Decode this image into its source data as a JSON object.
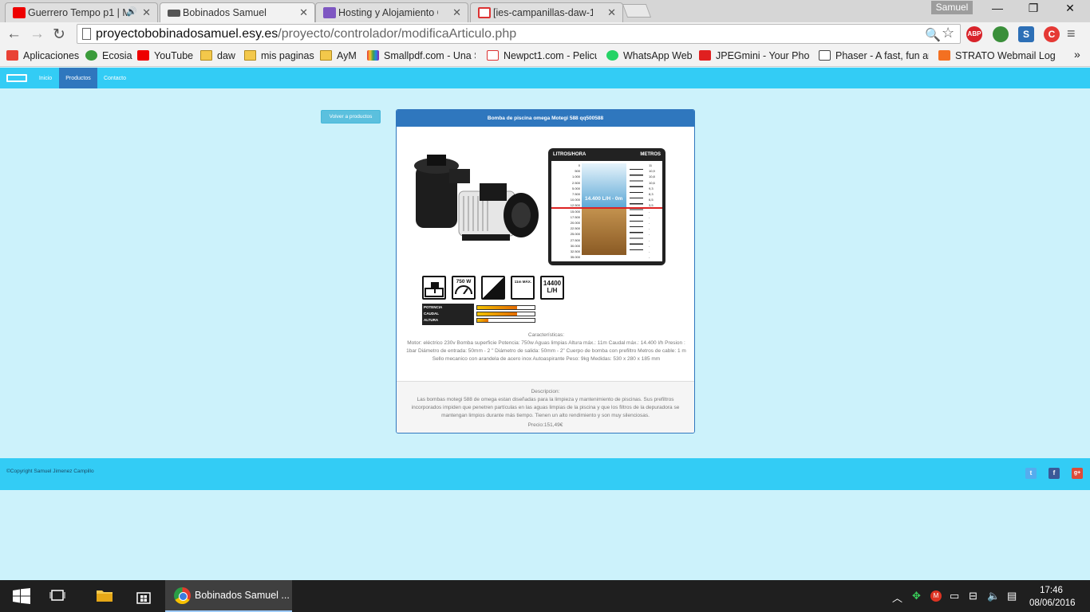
{
  "browser": {
    "tabs": [
      {
        "label": "Guerrero Tempo p1 | M",
        "favicon": "youtube-icon",
        "audio": "speaker-icon"
      },
      {
        "label": "Bobinados Samuel",
        "favicon": "motor-icon",
        "active": true
      },
      {
        "label": "Hosting y Alojamiento Gr",
        "favicon": "hostinger-icon"
      },
      {
        "label": "[ies-campanillas-daw-141",
        "favicon": "gmail-icon"
      }
    ],
    "profile_name": "Samuel",
    "window_controls": {
      "minimize": "—",
      "restore": "❐",
      "close": "✕"
    },
    "url_host": "proyectobobinadosamuel.esy.es",
    "url_path": "/proyecto/controlador/modificaArticulo.php",
    "extensions": [
      {
        "name": "adblock-icon",
        "label": "ABP",
        "color": "#d8232a"
      },
      {
        "name": "globe-icon",
        "label": "",
        "color": "#3a8f3a"
      },
      {
        "name": "s-extension-icon",
        "label": "S",
        "color": "#2d6fb6"
      },
      {
        "name": "c-extension-icon",
        "label": "C",
        "color": "#e53935"
      }
    ],
    "bookmarks": [
      {
        "label": "Aplicaciones",
        "icon": "apps-grid-icon",
        "color": "#e94235"
      },
      {
        "label": "Ecosia",
        "icon": "ecosia-icon",
        "color": "#3b9b3b"
      },
      {
        "label": "YouTube",
        "icon": "youtube-icon",
        "color": "#e00"
      },
      {
        "label": "daw",
        "icon": "folder-icon",
        "color": "#f3c84b"
      },
      {
        "label": "mis paginas",
        "icon": "folder-icon",
        "color": "#f3c84b"
      },
      {
        "label": "AyM",
        "icon": "folder-icon",
        "color": "#f3c84b"
      },
      {
        "label": "Smallpdf.com - Una S",
        "icon": "smallpdf-icon",
        "color": "#9b3bd6"
      },
      {
        "label": "Newpct1.com - Pelicu",
        "icon": "newpct-icon",
        "color": "#d33"
      },
      {
        "label": "WhatsApp Web",
        "icon": "whatsapp-icon",
        "color": "#25d366"
      },
      {
        "label": "JPEGmini - Your Photo",
        "icon": "jpegmini-icon",
        "color": "#e02020"
      },
      {
        "label": "Phaser - A fast, fun an",
        "icon": "phaser-icon",
        "color": "#444"
      },
      {
        "label": "STRATO Webmail Log",
        "icon": "strato-icon",
        "color": "#f37021"
      }
    ]
  },
  "site": {
    "nav": {
      "home": "Inicio",
      "products": "Productos",
      "contact": "Contacto"
    },
    "back_button": "Volver a productos",
    "product": {
      "title": "Bomba de piscina omega Motegi 588 qq500588",
      "gauge": {
        "header_left": "LITROS/HORA",
        "header_right": "METROS",
        "flow_label": "14.400 L/H - 0m",
        "flow_values": [
          "0",
          "500",
          "1.000",
          "2.500",
          "5.000",
          "7.500",
          "10.000",
          "12.500",
          "15.000",
          "17.500",
          "20.000",
          "22.500",
          "25.000",
          "27.500",
          "30.000",
          "32.500",
          "35.000"
        ],
        "height_values": [
          "11",
          "10,9",
          "10,8",
          "10,6",
          "9,3",
          "8,3",
          "6,5",
          "3,5",
          "-",
          "-",
          "-",
          "-",
          "-",
          "-",
          "-",
          "-",
          "-"
        ]
      },
      "spec_icons": [
        {
          "name": "surface-pump-icon",
          "label": ""
        },
        {
          "name": "power-750w-icon",
          "label": "750 W"
        },
        {
          "name": "clean-water-icon",
          "label": ""
        },
        {
          "name": "max-height-icon",
          "label": "11m MÁX."
        },
        {
          "name": "flow-14400-icon",
          "label": "14400 L/H"
        }
      ],
      "levels": {
        "labels": [
          "POTENCIA",
          "CAUDAL",
          "ALTURA"
        ],
        "values": [
          0.7,
          0.7,
          0.2
        ]
      },
      "features_title": "Características:",
      "features_text": "Motor: eléctrico 230v Bomba superficie Potencia: 750w Aguas limpias Altura máx.: 11m Caudal máx.: 14.400 l/h Presion : 1bar Diámetro de entrada: 50mm - 2 \" Diámetro de salida: 50mm - 2\" Cuerpo de bomba con prefiltro Metros de cable: 1 m Sello mecanico con arandela de acero inox Autoaspirante Peso: 9kg Medidas: 530 x 280 x 185 mm",
      "description_title": "Descripcion:",
      "description_text": "Las bombas motegi 588 de omega estan diseñadas para la limpieza y mantenimiento de piscinas. Sus prefiltros incorporados impiden que penetren partículas en las aguas limpias de la piscina y que los filtros de la depuradora se mantengan limpios durante más tiempo. Tienen un alto rendimiento y son muy silenciosas.",
      "price": "Precio:151,49€"
    },
    "footer": {
      "copyright": "©Copyright Samuel Jimenez Campillo",
      "social": [
        {
          "name": "twitter-icon",
          "glyph": "t",
          "color": "#55acee"
        },
        {
          "name": "facebook-icon",
          "glyph": "f",
          "color": "#3b5998"
        },
        {
          "name": "google-plus-icon",
          "glyph": "g+",
          "color": "#dd4b39"
        }
      ]
    }
  },
  "taskbar": {
    "app_label": "Bobinados Samuel ...",
    "time": "17:46",
    "date": "08/06/2016"
  }
}
